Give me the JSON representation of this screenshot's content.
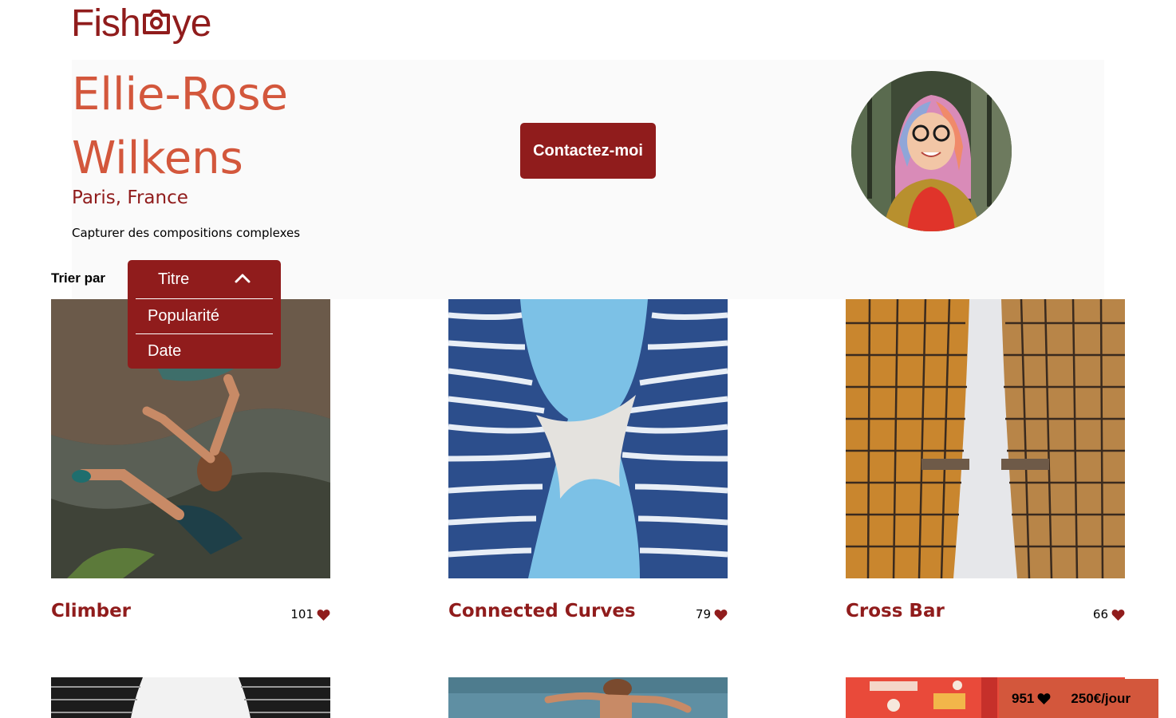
{
  "brand": {
    "logo_text_left": "Fish",
    "logo_text_right": "ye",
    "logo_icon": "camera-icon"
  },
  "colors": {
    "primary": "#901C1C",
    "secondary": "#D3573C",
    "panel": "#FAFAFA"
  },
  "photographer": {
    "name_line1": "Ellie-Rose",
    "name_line2": "Wilkens",
    "location": "Paris, France",
    "tagline": "Capturer des compositions complexes",
    "contact_label": "Contactez-moi",
    "portrait": "portrait-photo"
  },
  "sort": {
    "label": "Trier par",
    "options": [
      "Titre",
      "Popularité",
      "Date"
    ],
    "selected": "Titre",
    "state_icon": "chevron-up-icon"
  },
  "media": [
    {
      "title": "Climber",
      "likes": "101",
      "like_icon": "heart-icon"
    },
    {
      "title": "Connected Curves",
      "likes": "79",
      "like_icon": "heart-icon"
    },
    {
      "title": "Cross Bar",
      "likes": "66",
      "like_icon": "heart-icon"
    }
  ],
  "summary": {
    "total_likes": "951",
    "price": "250€/jour",
    "like_icon": "heart-icon"
  }
}
